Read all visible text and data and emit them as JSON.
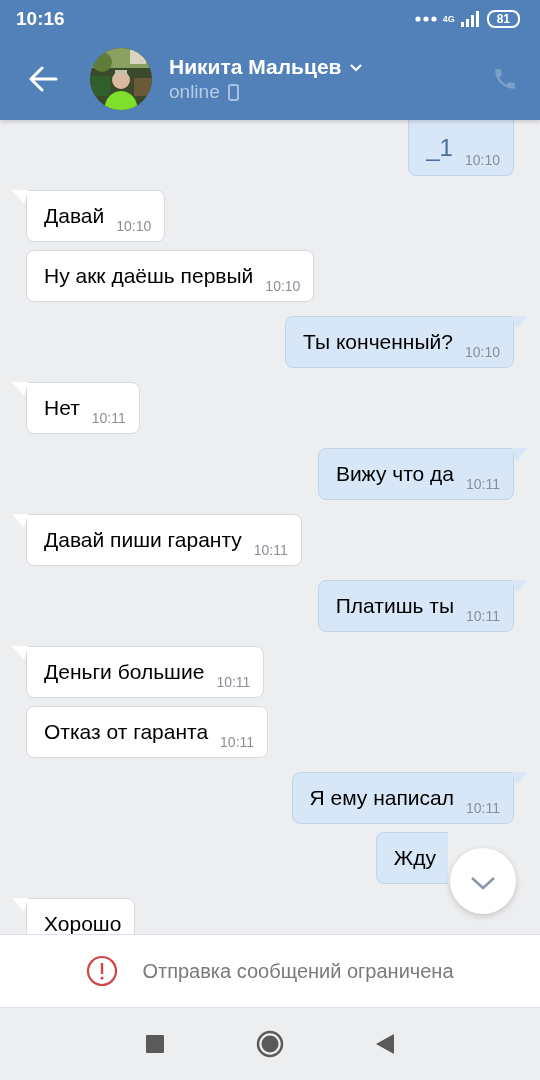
{
  "status_bar": {
    "time": "10:16",
    "network": "4G",
    "battery": "81"
  },
  "header": {
    "name": "Никита Мальцев",
    "status": "online",
    "call_disabled": true
  },
  "messages": [
    {
      "kind": "out",
      "text": "_1",
      "time": "10:10"
    },
    {
      "kind": "in",
      "text": "Давай",
      "time": "10:10"
    },
    {
      "kind": "in",
      "text": "Ну акк даёшь первый",
      "time": "10:10"
    },
    {
      "kind": "out",
      "text": "Ты конченный?",
      "time": "10:10"
    },
    {
      "kind": "in",
      "text": "Нет",
      "time": "10:11"
    },
    {
      "kind": "out",
      "text": "Вижу что да",
      "time": "10:11"
    },
    {
      "kind": "in",
      "text": "Давай пиши гаранту",
      "time": "10:11"
    },
    {
      "kind": "out",
      "text": "Платишь ты",
      "time": "10:11"
    },
    {
      "kind": "in",
      "text": "Деньги большие",
      "time": "10:11"
    },
    {
      "kind": "in",
      "text": "Отказ от гаранта",
      "time": "10:11"
    },
    {
      "kind": "out",
      "text": "Я ему написал",
      "time": "10:11"
    },
    {
      "kind": "out",
      "text": "Жду"
    },
    {
      "kind": "in",
      "text": "Хорошо"
    }
  ],
  "notice": {
    "text": "Отправка сообщений ограничена"
  }
}
